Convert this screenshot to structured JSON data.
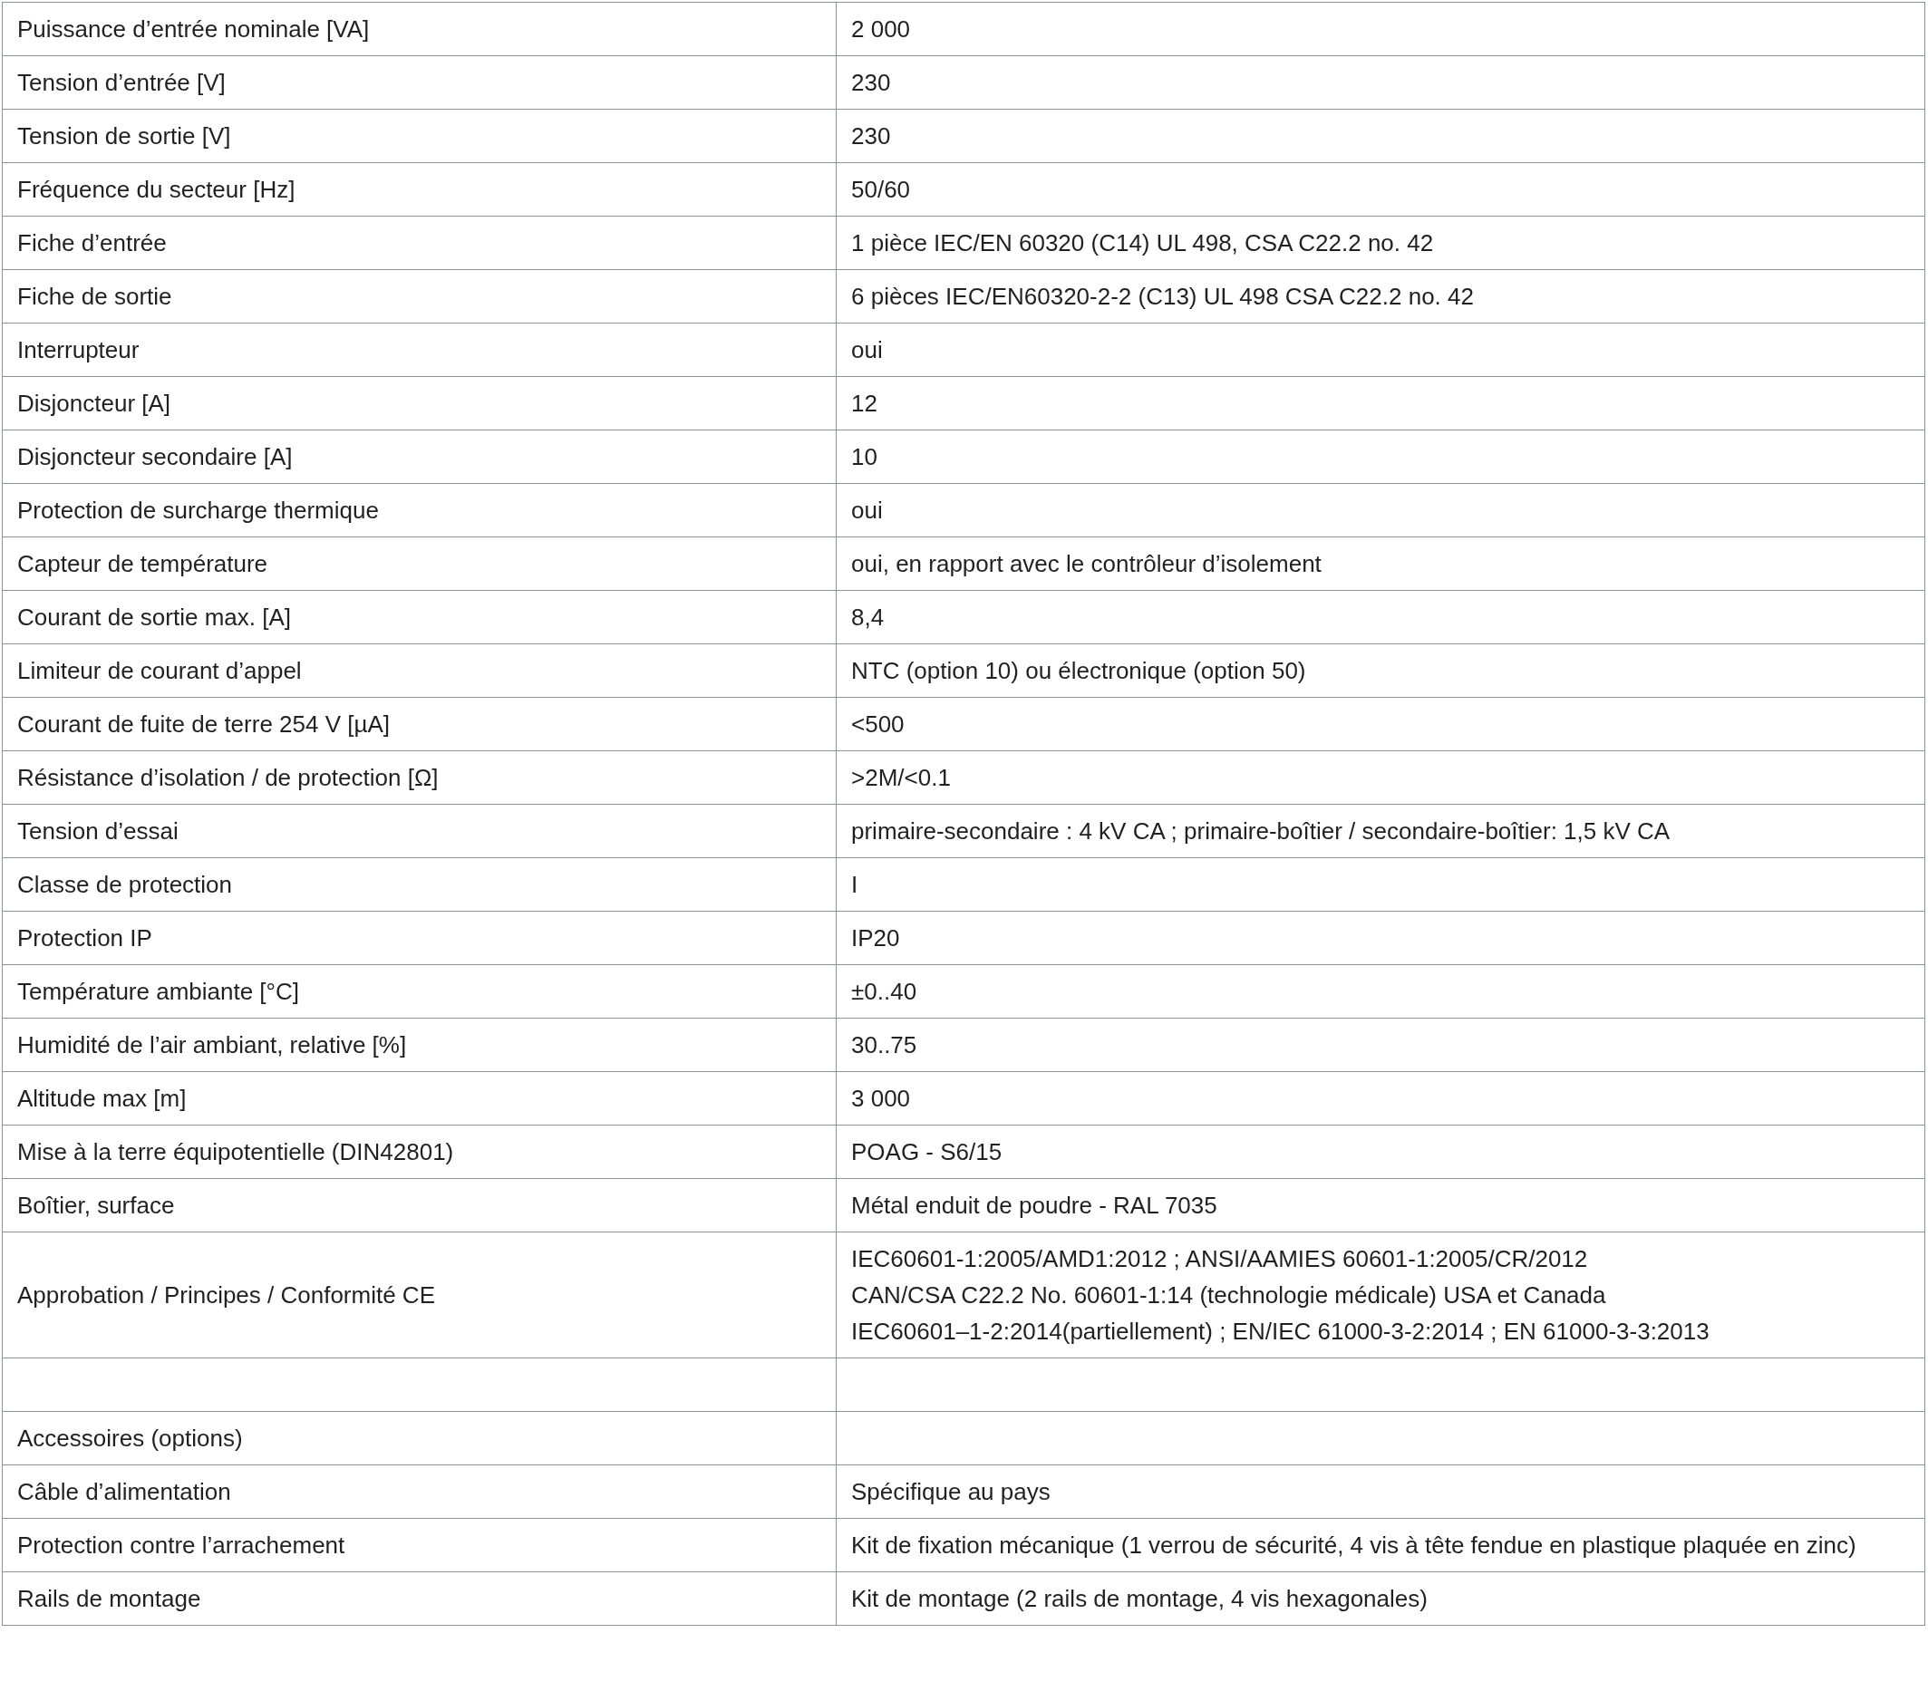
{
  "rows": [
    {
      "kind": "spec",
      "label": "Puissance d’entrée nominale [VA]",
      "value": [
        "2 000"
      ]
    },
    {
      "kind": "spec",
      "label": "Tension d’entrée [V]",
      "value": [
        "230"
      ]
    },
    {
      "kind": "spec",
      "label": "Tension de sortie [V]",
      "value": [
        "230"
      ]
    },
    {
      "kind": "spec",
      "label": "Fréquence du secteur [Hz]",
      "value": [
        "50/60"
      ]
    },
    {
      "kind": "spec",
      "label": "Fiche d’entrée",
      "value": [
        "1 pièce IEC/EN 60320 (C14) UL 498, CSA C22.2 no. 42"
      ]
    },
    {
      "kind": "spec",
      "label": "Fiche de sortie",
      "value": [
        "6 pièces IEC/EN60320-2-2 (C13) UL 498 CSA C22.2 no. 42"
      ]
    },
    {
      "kind": "spec",
      "label": "Interrupteur",
      "value": [
        "oui"
      ]
    },
    {
      "kind": "spec",
      "label": "Disjoncteur [A]",
      "value": [
        "12"
      ]
    },
    {
      "kind": "spec",
      "label": "Disjoncteur secondaire [A]",
      "value": [
        "10"
      ]
    },
    {
      "kind": "spec",
      "label": "Protection de surcharge thermique",
      "value": [
        "oui"
      ]
    },
    {
      "kind": "spec",
      "label": "Capteur de température",
      "value": [
        "oui, en rapport avec le contrôleur d’isolement"
      ]
    },
    {
      "kind": "spec",
      "label": "Courant de sortie max. [A]",
      "value": [
        "8,4"
      ]
    },
    {
      "kind": "spec",
      "label": "Limiteur de courant d’appel",
      "value": [
        "NTC (option 10) ou électronique (option 50)"
      ]
    },
    {
      "kind": "spec",
      "label": "Courant de fuite de terre 254 V [µA]",
      "value": [
        "<500"
      ]
    },
    {
      "kind": "spec",
      "label": "Résistance d’isolation / de protection [Ω]",
      "value": [
        ">2M/<0.1"
      ]
    },
    {
      "kind": "spec",
      "label": "Tension d’essai",
      "value": [
        "primaire-secondaire : 4 kV CA ; primaire-boîtier / secondaire-boîtier: 1,5 kV CA"
      ]
    },
    {
      "kind": "spec",
      "label": "Classe de protection",
      "value": [
        "I"
      ]
    },
    {
      "kind": "spec",
      "label": "Protection IP",
      "value": [
        "IP20"
      ]
    },
    {
      "kind": "spec",
      "label": "Température ambiante [°C]",
      "value": [
        "±0..40"
      ]
    },
    {
      "kind": "spec",
      "label": "Humidité de l’air ambiant, relative [%]",
      "value": [
        "30..75"
      ]
    },
    {
      "kind": "spec",
      "label": "Altitude max [m]",
      "value": [
        "3 000"
      ]
    },
    {
      "kind": "spec",
      "label": "Mise à la terre équipotentielle (DIN42801)",
      "value": [
        "POAG - S6/15"
      ]
    },
    {
      "kind": "spec",
      "label": "Boîtier, surface",
      "value": [
        "Métal enduit de poudre - RAL 7035"
      ]
    },
    {
      "kind": "spec",
      "label": "Approbation / Principes / Conformité CE",
      "value": [
        "IEC60601-1:2005/AMD1:2012 ; ANSI/AAMIES 60601-1:2005/CR/2012",
        "CAN/CSA C22.2 No. 60601-1:14 (technologie médicale) USA et Canada",
        "IEC60601–1-2:2014(partiellement) ; EN/IEC 61000-3-2:2014 ; EN 61000-3-3:2013"
      ]
    },
    {
      "kind": "blank"
    },
    {
      "kind": "spec",
      "label": "Accessoires (options)"
    },
    {
      "kind": "spec",
      "label": "Câble d’alimentation",
      "value": [
        "Spécifique au pays"
      ]
    },
    {
      "kind": "spec",
      "label": "Protection contre l’arrachement",
      "value": [
        "Kit de fixation mécanique (1 verrou de sécurité, 4 vis à tête fendue en plastique plaquée en zinc)"
      ]
    },
    {
      "kind": "spec",
      "label": "Rails de montage",
      "value": [
        "Kit de montage (2 rails de montage, 4 vis hexagonales)"
      ]
    }
  ]
}
